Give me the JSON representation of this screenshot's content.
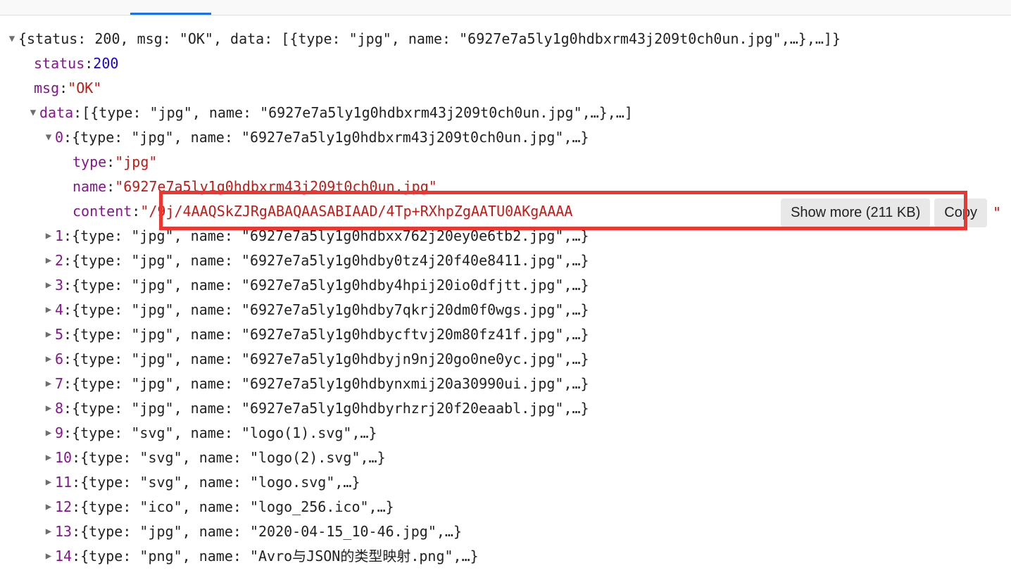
{
  "root": {
    "summary_prefix": "{status: 200, msg: \"OK\", data: [{type: \"jpg\", name: \"6927e7a5ly1g0hdbxrm43j209t0ch0un.jpg\",…},…]}",
    "status_key": "status",
    "status_val": "200",
    "msg_key": "msg",
    "msg_val": "\"OK\"",
    "data_key": "data",
    "data_summary": "[{type: \"jpg\", name: \"6927e7a5ly1g0hdbxrm43j209t0ch0un.jpg\",…},…]",
    "item0_key": "0",
    "item0_summary": "{type: \"jpg\", name: \"6927e7a5ly1g0hdbxrm43j209t0ch0un.jpg\",…}",
    "item0_type_key": "type",
    "item0_type_val": "\"jpg\"",
    "item0_name_key": "name",
    "item0_name_val": "\"6927e7a5ly1g0hdbxrm43j209t0ch0un.jpg\"",
    "item0_content_key": "content",
    "item0_content_val": "\"/9j/4AAQSkZJRgABAQAASABIAAD/4Tp+RXhpZgAATU0AKgAAAA",
    "show_more": "Show more (211 KB)",
    "copy": "Copy",
    "items": [
      {
        "idx": "1",
        "type": "jpg",
        "name": "6927e7a5ly1g0hdbxx762j20ey0e6tb2.jpg"
      },
      {
        "idx": "2",
        "type": "jpg",
        "name": "6927e7a5ly1g0hdby0tz4j20f40e8411.jpg"
      },
      {
        "idx": "3",
        "type": "jpg",
        "name": "6927e7a5ly1g0hdby4hpij20io0dfjtt.jpg"
      },
      {
        "idx": "4",
        "type": "jpg",
        "name": "6927e7a5ly1g0hdby7qkrj20dm0f0wgs.jpg"
      },
      {
        "idx": "5",
        "type": "jpg",
        "name": "6927e7a5ly1g0hdbycftvj20m80fz41f.jpg"
      },
      {
        "idx": "6",
        "type": "jpg",
        "name": "6927e7a5ly1g0hdbyjn9nj20go0ne0yc.jpg"
      },
      {
        "idx": "7",
        "type": "jpg",
        "name": "6927e7a5ly1g0hdbynxmij20a30990ui.jpg"
      },
      {
        "idx": "8",
        "type": "jpg",
        "name": "6927e7a5ly1g0hdbyrhzrj20f20eaabl.jpg"
      },
      {
        "idx": "9",
        "type": "svg",
        "name": "logo(1).svg"
      },
      {
        "idx": "10",
        "type": "svg",
        "name": "logo(2).svg"
      },
      {
        "idx": "11",
        "type": "svg",
        "name": "logo.svg"
      },
      {
        "idx": "12",
        "type": "ico",
        "name": "logo_256.ico"
      },
      {
        "idx": "13",
        "type": "jpg",
        "name": "2020-04-15_10-46.jpg"
      },
      {
        "idx": "14",
        "type": "png",
        "name": "Avro与JSON的类型映射.png"
      }
    ]
  }
}
